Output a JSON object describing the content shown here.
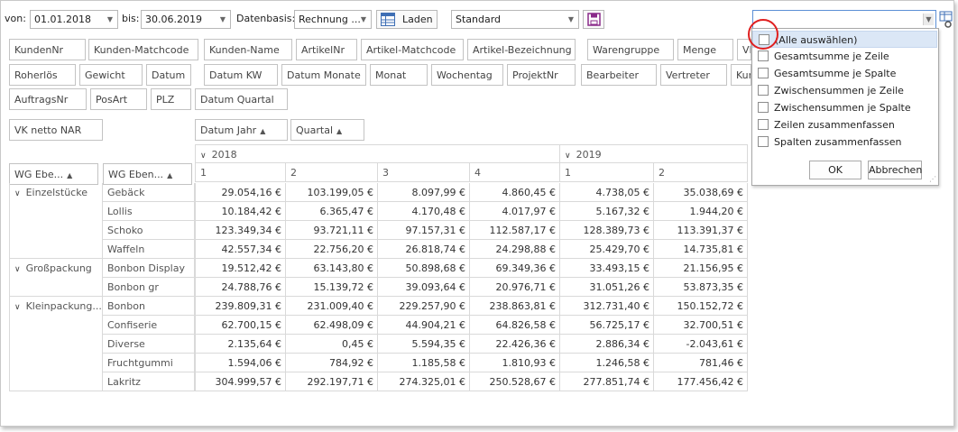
{
  "toolbar": {
    "from_label": "von:",
    "from_value": "01.01.2018",
    "to_label": "bis:",
    "to_value": "30.06.2019",
    "basis_label": "Datenbasis:",
    "basis_value": "Rechnung ...",
    "load_label": "Laden",
    "layout_value": "Standard",
    "right_combo_value": ""
  },
  "field_chips_row1": [
    "KundenNr",
    "Kunden-Matchcode",
    "Kunden-Name",
    "ArtikelNr",
    "Artikel-Matchcode",
    "Artikel-Bezeichnung",
    "Warengruppe",
    "Menge",
    "VK"
  ],
  "field_chips_row2": [
    "Roherlös",
    "Gewicht",
    "Datum",
    "Datum KW",
    "Datum Monate",
    "Monat",
    "Wochentag",
    "ProjektNr",
    "Bearbeiter",
    "Vertreter",
    "Kund"
  ],
  "field_chips_row3": [
    "AuftragsNr",
    "PosArt",
    "PLZ",
    "Datum Quartal"
  ],
  "data_field": "VK netto NAR",
  "column_fields": [
    {
      "label": "Datum Jahr",
      "sort": "▲"
    },
    {
      "label": "Quartal",
      "sort": "▲"
    }
  ],
  "row_fields": [
    {
      "label": "WG Ebe...",
      "sort": "▲"
    },
    {
      "label": "WG Eben...",
      "sort": "▲"
    }
  ],
  "years": [
    {
      "label": "2018",
      "quarters": [
        "1",
        "2",
        "3",
        "4"
      ]
    },
    {
      "label": "2019",
      "quarters": [
        "1",
        "2"
      ]
    }
  ],
  "groups": [
    {
      "name": "Einzelstücke",
      "rows": [
        {
          "name": "Gebäck",
          "values": [
            "29.054,16 €",
            "103.199,05 €",
            "8.097,99 €",
            "4.860,45 €",
            "4.738,05 €",
            "35.038,69 €"
          ]
        },
        {
          "name": "Lollis",
          "values": [
            "10.184,42 €",
            "6.365,47 €",
            "4.170,48 €",
            "4.017,97 €",
            "5.167,32 €",
            "1.944,20 €"
          ]
        },
        {
          "name": "Schoko",
          "values": [
            "123.349,34 €",
            "93.721,11 €",
            "97.157,31 €",
            "112.587,17 €",
            "128.389,73 €",
            "113.391,37 €"
          ]
        },
        {
          "name": "Waffeln",
          "values": [
            "42.557,34 €",
            "22.756,20 €",
            "26.818,74 €",
            "24.298,88 €",
            "25.429,70 €",
            "14.735,81 €"
          ]
        }
      ]
    },
    {
      "name": "Großpackung",
      "rows": [
        {
          "name": "Bonbon Display",
          "values": [
            "19.512,42 €",
            "63.143,80 €",
            "50.898,68 €",
            "69.349,36 €",
            "33.493,15 €",
            "21.156,95 €"
          ]
        },
        {
          "name": "Bonbon gr",
          "values": [
            "24.788,76 €",
            "15.139,72 €",
            "39.093,64 €",
            "20.976,71 €",
            "31.051,26 €",
            "53.873,35 €"
          ]
        }
      ]
    },
    {
      "name": "Kleinpackung...",
      "rows": [
        {
          "name": "Bonbon",
          "values": [
            "239.809,31 €",
            "231.009,40 €",
            "229.257,90 €",
            "238.863,81 €",
            "312.731,40 €",
            "150.152,72 €"
          ]
        },
        {
          "name": "Confiserie",
          "values": [
            "62.700,15 €",
            "62.498,09 €",
            "44.904,21 €",
            "64.826,58 €",
            "56.725,17 €",
            "32.700,51 €"
          ]
        },
        {
          "name": "Diverse",
          "values": [
            "2.135,64 €",
            "0,45 €",
            "5.594,35 €",
            "22.426,36 €",
            "2.886,34 €",
            "-2.043,61 €"
          ]
        },
        {
          "name": "Fruchtgummi",
          "values": [
            "1.594,06 €",
            "784,92 €",
            "1.185,58 €",
            "1.810,93 €",
            "1.246,58 €",
            "781,46 €"
          ]
        },
        {
          "name": "Lakritz",
          "values": [
            "304.999,57 €",
            "292.197,71 €",
            "274.325,01 €",
            "250.528,67 €",
            "277.851,74 €",
            "177.456,42 €"
          ]
        }
      ]
    }
  ],
  "popup": {
    "items": [
      {
        "label": "(Alle auswählen)",
        "highlighted": true
      },
      {
        "label": "Gesamtsumme je Zeile"
      },
      {
        "label": "Gesamtsumme je Spalte"
      },
      {
        "label": "Zwischensummen je Zeile"
      },
      {
        "label": "Zwischensummen je Spalte"
      },
      {
        "label": "Zeilen zusammenfassen"
      },
      {
        "label": "Spalten zusammenfassen"
      }
    ],
    "ok_label": "OK",
    "cancel_label": "Abbrechen"
  },
  "colors": {
    "highlight": "#dbe7f6",
    "annotation_circle": "#e02020",
    "save_icon": "#8a2a8a"
  }
}
